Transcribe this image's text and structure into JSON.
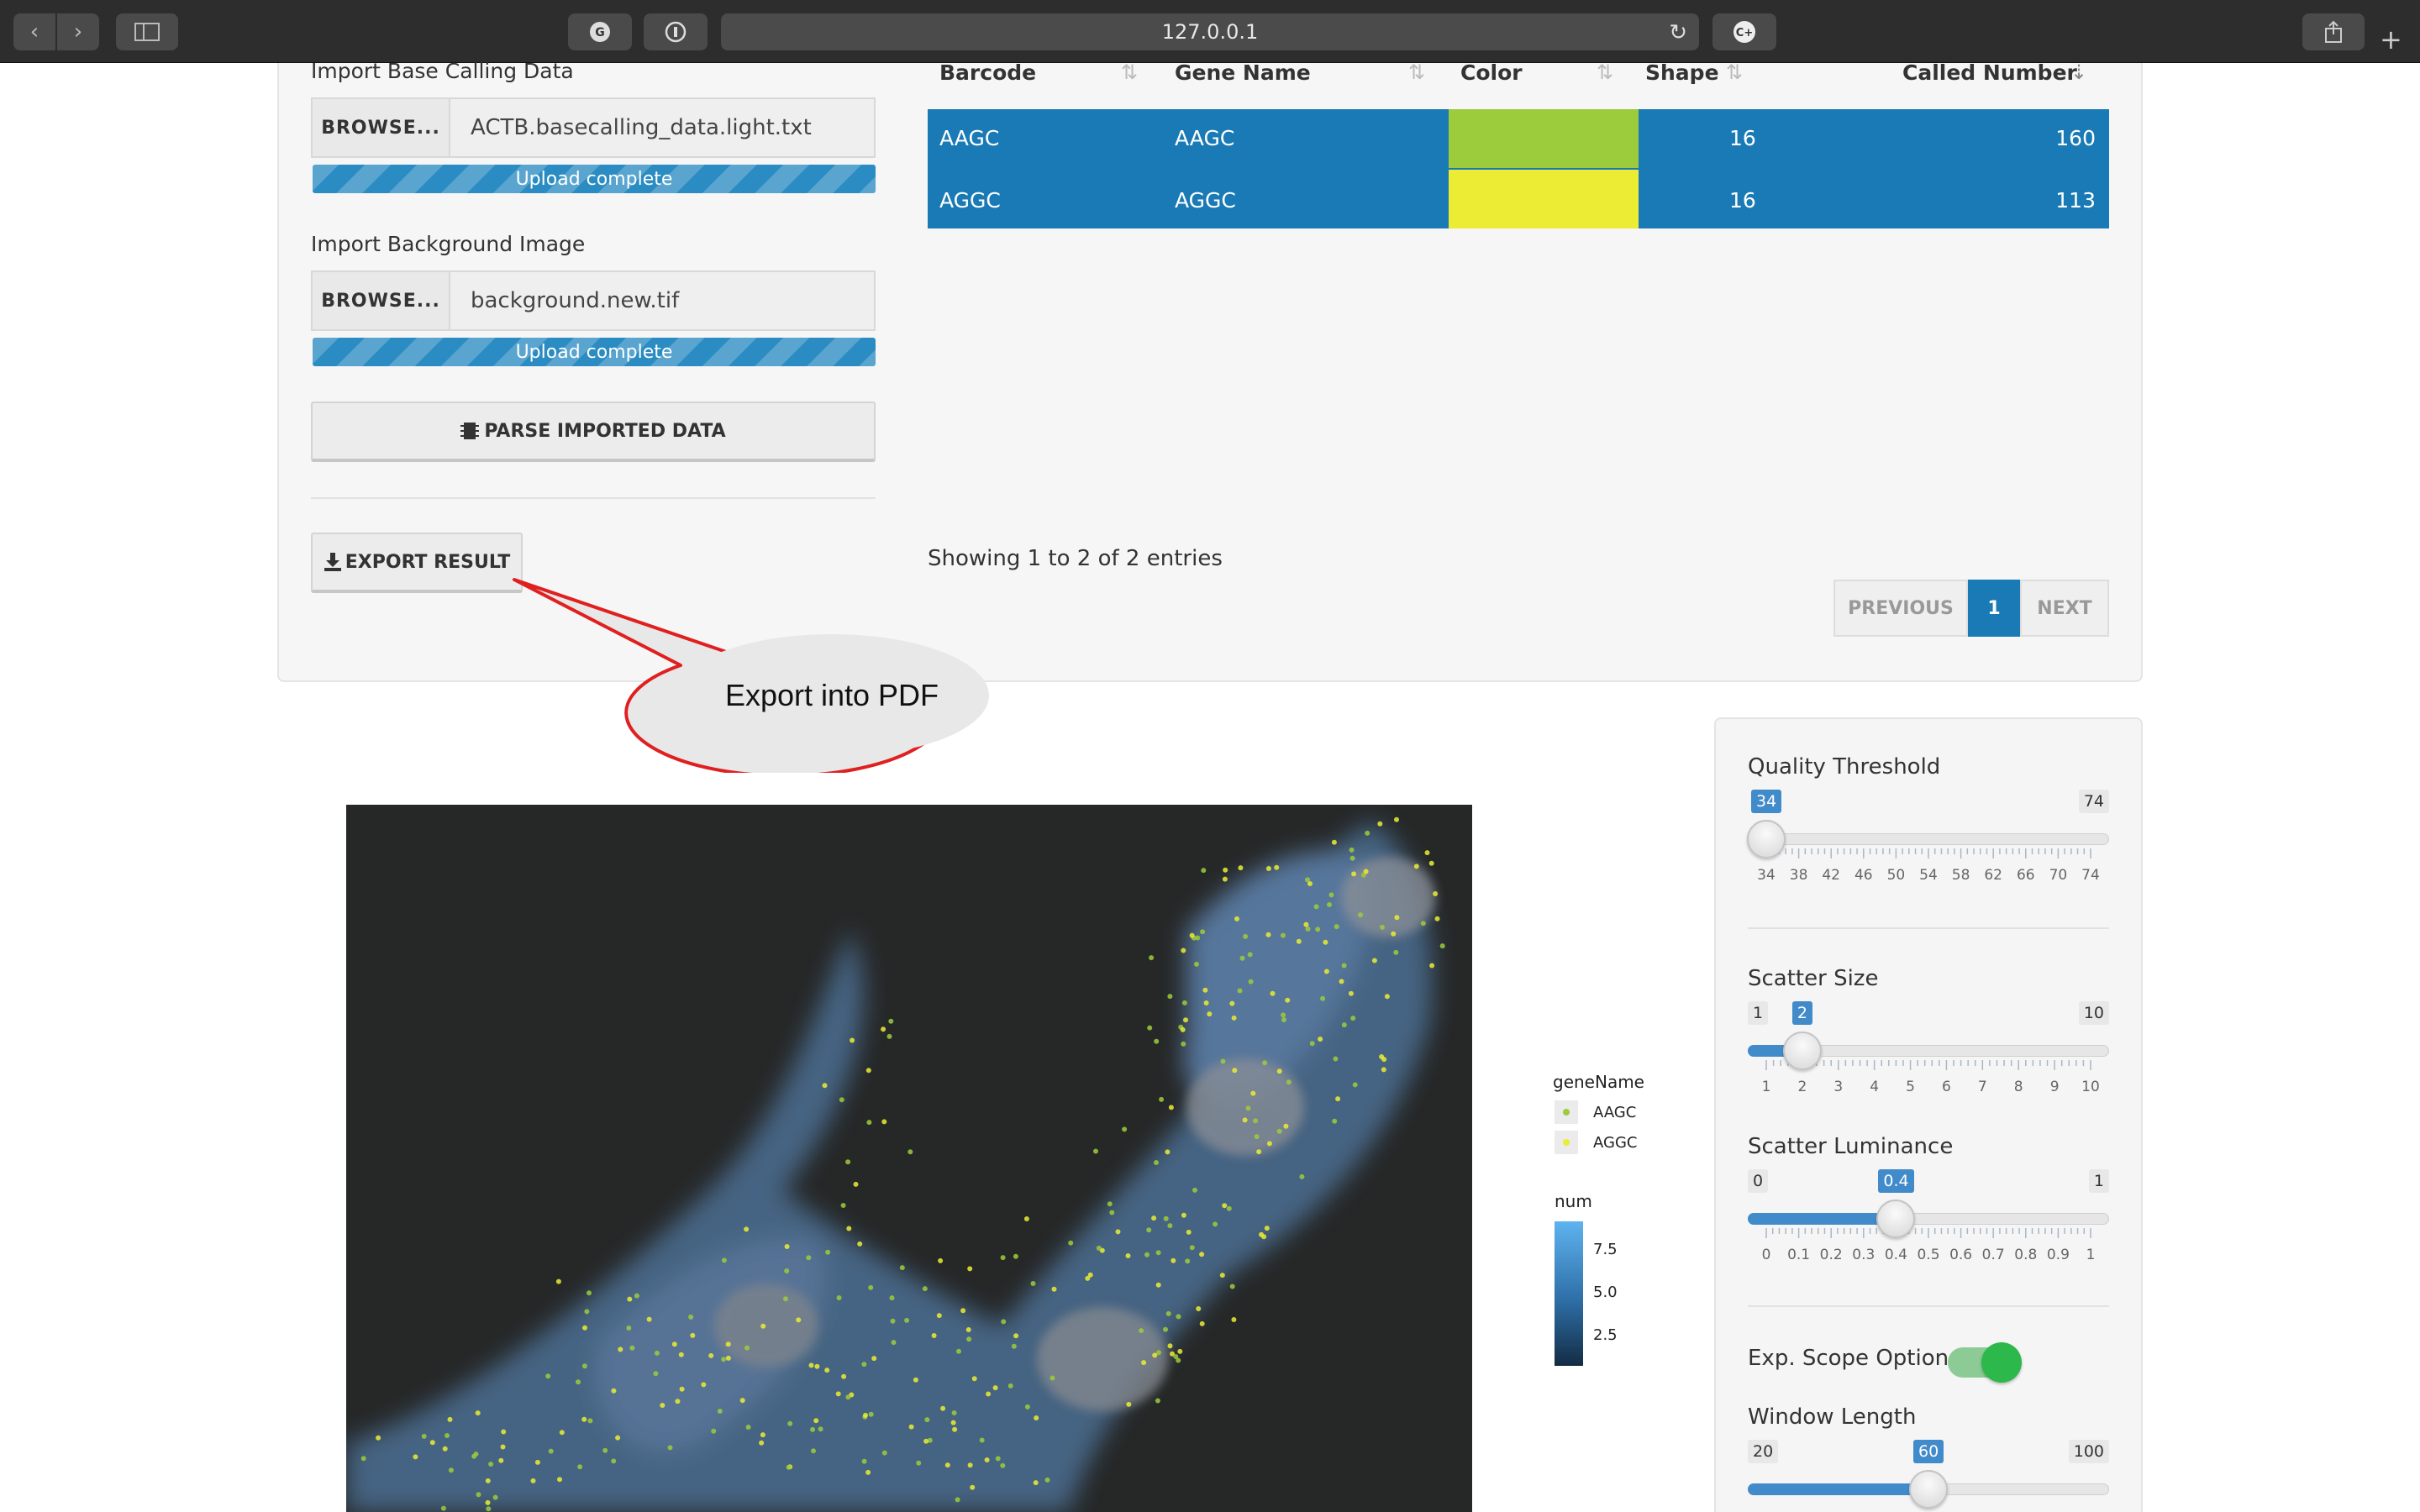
{
  "browser": {
    "url": "127.0.0.1"
  },
  "import": {
    "base_calling": {
      "label": "Import Base Calling Data",
      "browse_label": "BROWSE...",
      "file_name": "ACTB.basecalling_data.light.txt",
      "progress_text": "Upload complete",
      "progress": 1.0
    },
    "background": {
      "label": "Import Background Image",
      "browse_label": "BROWSE...",
      "file_name": "background.new.tif",
      "progress_text": "Upload complete",
      "progress": 1.0
    },
    "parse_label": "PARSE IMPORTED DATA",
    "export_label": "EXPORT RESULT"
  },
  "callout": {
    "text": "Export into PDF"
  },
  "table": {
    "columns": [
      "Barcode",
      "Gene Name",
      "Color",
      "Shape",
      "Called Number"
    ],
    "rows": [
      {
        "barcode": "AAGC",
        "gene": "AAGC",
        "color": "#9ccb3b",
        "shape": "16",
        "called": "160"
      },
      {
        "barcode": "AGGC",
        "gene": "AGGC",
        "color": "#ebec33",
        "shape": "16",
        "called": "113"
      }
    ],
    "info": "Showing 1 to 2 of 2 entries",
    "pagination": {
      "previous": "PREVIOUS",
      "current": "1",
      "next": "NEXT"
    }
  },
  "controls": {
    "quality": {
      "label": "Quality Threshold",
      "min": "34",
      "max": "74",
      "value": "34",
      "ticks": [
        "34",
        "38",
        "42",
        "46",
        "50",
        "54",
        "58",
        "62",
        "66",
        "70",
        "74"
      ]
    },
    "scatter_size": {
      "label": "Scatter Size",
      "min": "1",
      "max": "10",
      "value": "2",
      "ticks": [
        "1",
        "2",
        "3",
        "4",
        "5",
        "6",
        "7",
        "8",
        "9",
        "10"
      ]
    },
    "scatter_lum": {
      "label": "Scatter Luminance",
      "min": "0",
      "max": "1",
      "value": "0.4",
      "ticks": [
        "0",
        "0.1",
        "0.2",
        "0.3",
        "0.4",
        "0.5",
        "0.6",
        "0.7",
        "0.8",
        "0.9",
        "1"
      ]
    },
    "exp_scope": {
      "label": "Exp. Scope Option",
      "on": true
    },
    "window_length": {
      "label": "Window Length",
      "min": "20",
      "max": "100",
      "value": "60"
    }
  },
  "legend": {
    "gene_title": "geneName",
    "genes": [
      {
        "name": "AAGC",
        "color": "#9ccb3b"
      },
      {
        "name": "AGGC",
        "color": "#ebec33"
      }
    ],
    "num_title": "num",
    "num_ticks": [
      "7.5",
      "5.0",
      "2.5"
    ]
  },
  "colors": {
    "accent": "#428bca",
    "table_row": "#1a7ab5",
    "toggle_on": "#2db84b"
  }
}
